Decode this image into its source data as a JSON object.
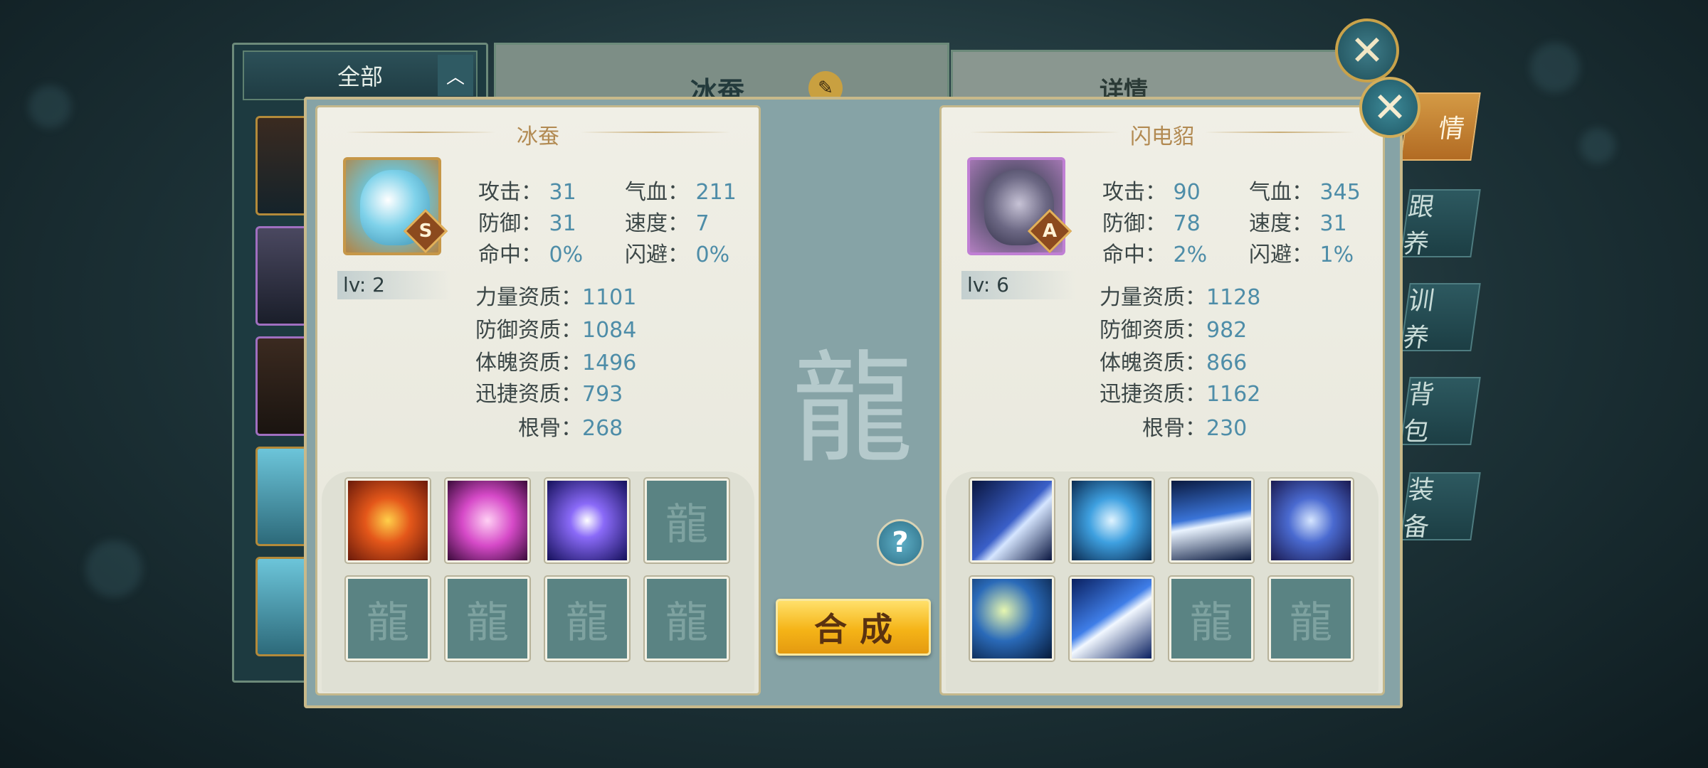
{
  "background": {
    "filter_tab": "全部",
    "center_title": "冰蚕",
    "right_title": "详情",
    "side_tabs": [
      "情",
      "跟 养",
      "训 养",
      "背 包",
      "装 备"
    ]
  },
  "left_pet": {
    "name": "冰蚕",
    "rank": "S",
    "level": "lv: 2",
    "stats": [
      {
        "label": "攻击：",
        "value": "31"
      },
      {
        "label": "气血：",
        "value": "211"
      },
      {
        "label": "防御：",
        "value": "31"
      },
      {
        "label": "速度：",
        "value": "7"
      },
      {
        "label": "命中：",
        "value": "0%"
      },
      {
        "label": "闪避：",
        "value": "0%"
      }
    ],
    "aptitudes": [
      {
        "label": "力量资质：",
        "value": "1101"
      },
      {
        "label": "防御资质：",
        "value": "1084"
      },
      {
        "label": "体魄资质：",
        "value": "1496"
      },
      {
        "label": "迅捷资质：",
        "value": "793"
      },
      {
        "label": "根骨：",
        "value": "268"
      }
    ],
    "skills": [
      {
        "icon": "fire-orb-skill-icon",
        "color": "#d23a12"
      },
      {
        "icon": "pink-vortex-skill-icon",
        "color": "#d64ac8"
      },
      {
        "icon": "lightning-orb-skill-icon",
        "color": "#5a3ad8"
      },
      {
        "icon": "empty-skill-slot",
        "color": ""
      },
      {
        "icon": "empty-skill-slot",
        "color": ""
      },
      {
        "icon": "empty-skill-slot",
        "color": ""
      },
      {
        "icon": "empty-skill-slot",
        "color": ""
      },
      {
        "icon": "empty-skill-slot",
        "color": ""
      }
    ]
  },
  "right_pet": {
    "name": "闪电貂",
    "rank": "A",
    "level": "lv: 6",
    "stats": [
      {
        "label": "攻击：",
        "value": "90"
      },
      {
        "label": "气血：",
        "value": "345"
      },
      {
        "label": "防御：",
        "value": "78"
      },
      {
        "label": "速度：",
        "value": "31"
      },
      {
        "label": "命中：",
        "value": "2%"
      },
      {
        "label": "闪避：",
        "value": "1%"
      }
    ],
    "aptitudes": [
      {
        "label": "力量资质：",
        "value": "1128"
      },
      {
        "label": "防御资质：",
        "value": "982"
      },
      {
        "label": "体魄资质：",
        "value": "866"
      },
      {
        "label": "迅捷资质：",
        "value": "1162"
      },
      {
        "label": "根骨：",
        "value": "230"
      }
    ],
    "skills": [
      {
        "icon": "claw-slash-skill-icon",
        "color": "#3a5fc8"
      },
      {
        "icon": "heart-shield-skill-icon",
        "color": "#3ea0e0"
      },
      {
        "icon": "speed-dash-skill-icon",
        "color": "#3a74d8"
      },
      {
        "icon": "shield-buff-skill-icon",
        "color": "#4a6ad0"
      },
      {
        "icon": "lightning-strike-skill-icon",
        "color": "#2a6ab8"
      },
      {
        "icon": "lightning-bolt-skill-icon",
        "color": "#3f7ee8"
      },
      {
        "icon": "empty-skill-slot",
        "color": ""
      },
      {
        "icon": "empty-skill-slot",
        "color": ""
      }
    ]
  },
  "center": {
    "combine_label": "合成",
    "help_label": "?"
  },
  "colors": {
    "gold_button": "#f5b417",
    "stat_value": "#4e8da8",
    "panel": "#f0efe6"
  }
}
